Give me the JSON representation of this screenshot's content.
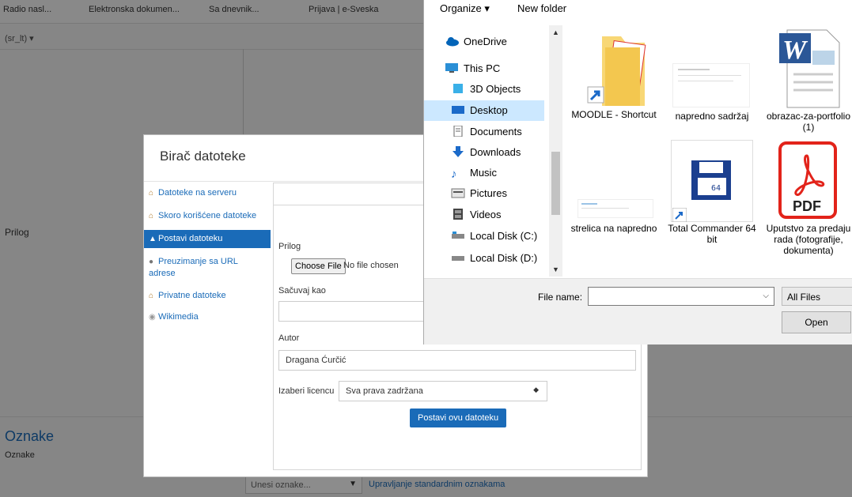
{
  "bookmarks": [
    "Radio nasl...",
    "Elektronska dokumen...",
    "Sa dnevnik...",
    "Prijava | e-Sveska"
  ],
  "background": {
    "language": "(sr_lt) ▾",
    "prilog_label": "Prilog",
    "oznake_heading": "Oznake",
    "oznake_label": "Oznake",
    "tags_placeholder": "Unesi oznake...",
    "tags_link": "Upravljanje standardnim oznakama"
  },
  "file_picker": {
    "title": "Birač datoteke",
    "nav": [
      "Datoteke na serveru",
      "Skoro korišćene datoteke",
      "Postavi datoteku",
      "Preuzimanje sa URL adrese",
      "Privatne datoteke",
      "Wikimedia"
    ],
    "active_index": 2,
    "prilog_label": "Prilog",
    "choose_file_label": "Choose File",
    "no_file_text": "No file chosen",
    "save_as_label": "Sačuvaj kao",
    "save_as_value": "",
    "author_label": "Autor",
    "author_value": "Dragana Ćurčić",
    "license_label": "Izaberi licencu",
    "license_value": "Sva prava zadržana",
    "upload_button": "Postavi ovu datoteku"
  },
  "save_dialog": {
    "toolbar": {
      "organize": "Organize ▾",
      "new_folder": "New folder"
    },
    "nav_items": [
      "OneDrive",
      "This PC",
      "3D Objects",
      "Desktop",
      "Documents",
      "Downloads",
      "Music",
      "Pictures",
      "Videos",
      "Local Disk (C:)",
      "Local Disk (D:)"
    ],
    "selected_nav": "Desktop",
    "files": [
      {
        "name": "MOODLE - Shortcut",
        "icon": "folder-shortcut-icon"
      },
      {
        "name": "napredno sadržaj",
        "icon": "image-thumbnail-icon"
      },
      {
        "name": "obrazac-za-portfolio (1)",
        "icon": "word-document-icon"
      },
      {
        "name": "strelica na napredno",
        "icon": "image-shortcut-icon"
      },
      {
        "name": "Total Commander 64 bit",
        "icon": "total-commander-icon"
      },
      {
        "name": "Uputstvo za predaju rada (fotografije, dokumenta)",
        "icon": "pdf-icon"
      }
    ],
    "file_name_label": "File name:",
    "file_name_value": "",
    "filter": "All Files",
    "open_button": "Open",
    "colors": {
      "selection": "#cce8ff",
      "pdf_red": "#e2231a",
      "word_blue": "#2b5797",
      "folder_yellow": "#f8d775"
    }
  }
}
